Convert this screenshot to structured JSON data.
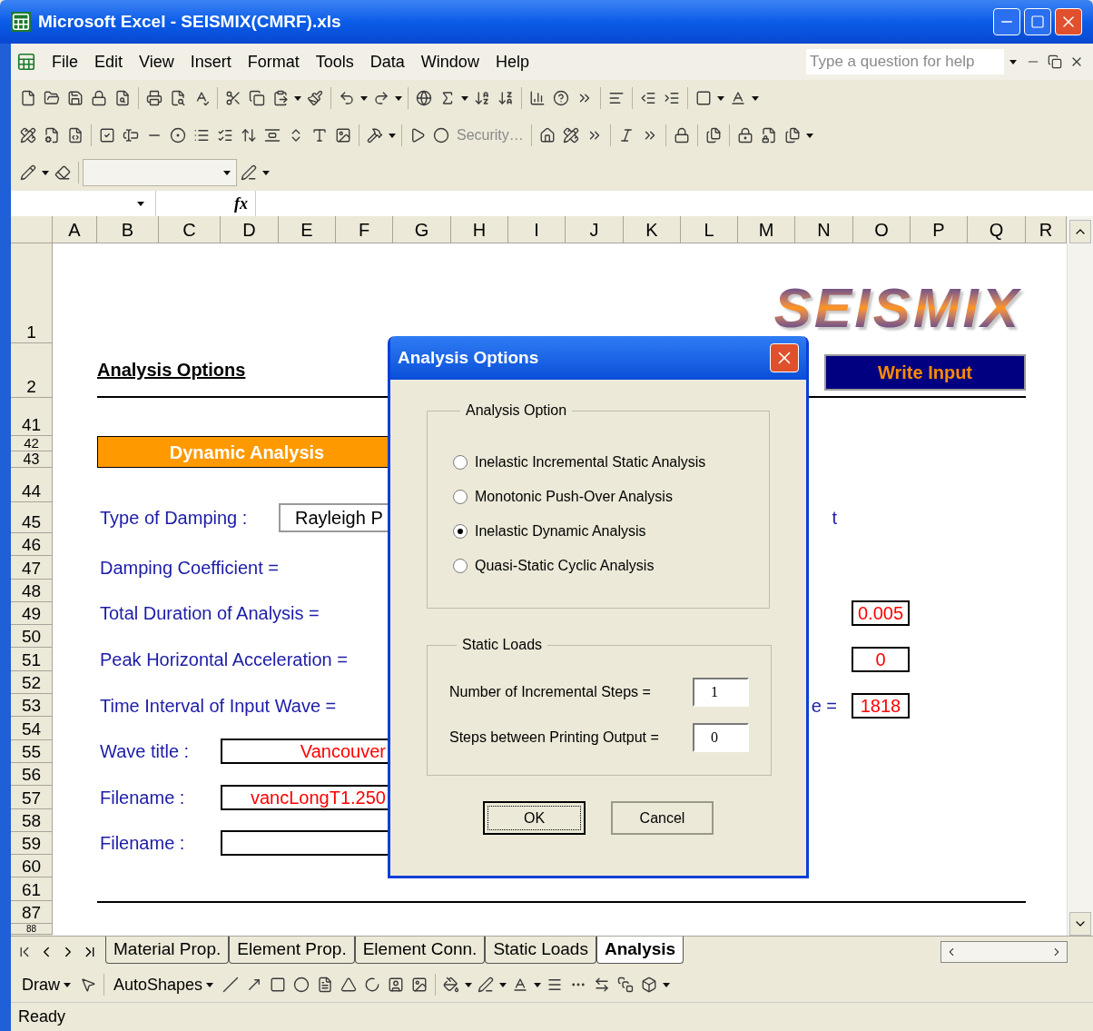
{
  "window": {
    "title": "Microsoft Excel - SEISMIX(CMRF).xls"
  },
  "menu": {
    "items": [
      "File",
      "Edit",
      "View",
      "Insert",
      "Format",
      "Tools",
      "Data",
      "Window",
      "Help"
    ],
    "help_box": {
      "placeholder": "Type a question for help"
    }
  },
  "forms_toolbar": {
    "security_label": "Security…"
  },
  "formula_bar": {
    "function_label": "fx"
  },
  "columns": [
    "A",
    "B",
    "C",
    "D",
    "E",
    "F",
    "G",
    "H",
    "I",
    "J",
    "K",
    "L",
    "M",
    "N",
    "O",
    "P",
    "Q",
    "R"
  ],
  "rows": [
    "1",
    "2",
    "41",
    "42",
    "43",
    "44",
    "45",
    "46",
    "47",
    "48",
    "49",
    "50",
    "51",
    "52",
    "53",
    "54",
    "55",
    "56",
    "57",
    "58",
    "59",
    "60",
    "61",
    "87",
    "88"
  ],
  "sheet": {
    "logo": "SEISMIX",
    "heading": "Analysis Options",
    "write_button": "Write Input",
    "section_title": "Dynamic Analysis",
    "lines": [
      {
        "kind": "dropdown",
        "label": "Type of Damping :",
        "value": "Rayleigh P",
        "right_label": "t"
      },
      {
        "kind": "plain",
        "label": "Damping Coefficient ="
      },
      {
        "kind": "plain",
        "label": "Total Duration of Analysis =",
        "right_value": "0.005"
      },
      {
        "kind": "plain",
        "label": "Peak Horizontal Acceleration =",
        "right_value": "0"
      },
      {
        "kind": "plain",
        "label": "Time Interval of Input Wave =",
        "right_label": "e =",
        "right_value": "1818"
      },
      {
        "kind": "cell",
        "label": "Wave title :",
        "value": "Vancouver"
      },
      {
        "kind": "cell",
        "label": "Filename :",
        "value": "vancLongT1.250"
      },
      {
        "kind": "cell",
        "label": "Filename :"
      }
    ]
  },
  "dialog": {
    "title": "Analysis Options",
    "option_group": {
      "title": "Analysis Option",
      "options": [
        {
          "label": "Inelastic Incremental Static Analysis",
          "selected": false
        },
        {
          "label": "Monotonic Push-Over Analysis",
          "selected": false
        },
        {
          "label": "Inelastic Dynamic Analysis",
          "selected": true
        },
        {
          "label": "Quasi-Static Cyclic Analysis",
          "selected": false
        }
      ]
    },
    "static_group": {
      "title": "Static Loads",
      "fields": [
        {
          "label": "Number of Incremental Steps =",
          "value": "1"
        },
        {
          "label": "Steps between Printing Output =",
          "value": "0"
        }
      ]
    },
    "buttons": [
      "OK",
      "Cancel"
    ]
  },
  "sheet_tabs": [
    {
      "label": "Material Prop.",
      "selected": false
    },
    {
      "label": "Element Prop.",
      "selected": false
    },
    {
      "label": "Element Conn.",
      "selected": false
    },
    {
      "label": "Static Loads",
      "selected": false
    },
    {
      "label": "Analysis",
      "selected": true
    }
  ],
  "drawing_toolbar": {
    "draw": "Draw",
    "autoshapes": "AutoShapes"
  },
  "status_bar": {
    "text": "Ready"
  }
}
